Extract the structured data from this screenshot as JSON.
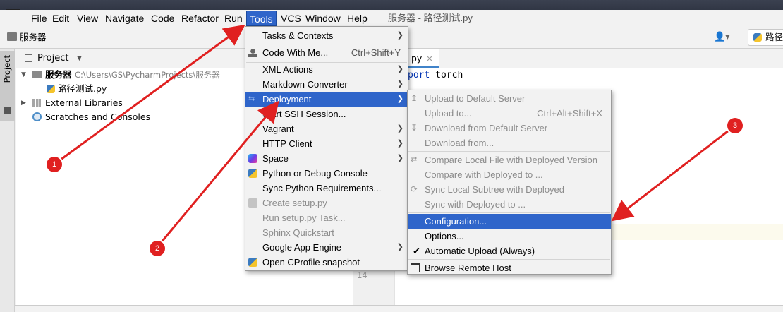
{
  "menubar": {
    "logo": "PC",
    "items": [
      {
        "label": "File"
      },
      {
        "label": "Edit"
      },
      {
        "label": "View"
      },
      {
        "label": "Navigate"
      },
      {
        "label": "Code"
      },
      {
        "label": "Refactor"
      },
      {
        "label": "Run"
      },
      {
        "label": "Tools"
      },
      {
        "label": "VCS"
      },
      {
        "label": "Window"
      },
      {
        "label": "Help"
      }
    ],
    "window_title": "服务器 - 路径测试.py"
  },
  "navbar": {
    "breadcrumb": "服务器",
    "run_config": "路径"
  },
  "sidebar_stripe": {
    "project_tab": "Project"
  },
  "project_panel": {
    "title": "Project",
    "root_name": "服务器",
    "root_path": "C:\\Users\\GS\\PycharmProjects\\服务器",
    "file": "路径测试.py",
    "external_libraries": "External Libraries",
    "scratches": "Scratches and Consoles"
  },
  "editor": {
    "tab_label": "py",
    "code_keyword": "port",
    "code_rest": " torch",
    "line_14": "14"
  },
  "tools_menu": {
    "items": [
      {
        "label": "Tasks & Contexts",
        "shortcut": "",
        "submenu": true,
        "disabled": false
      },
      {
        "label": "Code With Me...",
        "shortcut": "Ctrl+Shift+Y",
        "submenu": false,
        "disabled": false
      },
      {
        "label": "XML Actions",
        "shortcut": "",
        "submenu": true,
        "disabled": false
      },
      {
        "label": "Markdown Converter",
        "shortcut": "",
        "submenu": true,
        "disabled": false
      },
      {
        "label": "Deployment",
        "shortcut": "",
        "submenu": true,
        "disabled": false
      },
      {
        "label": "Start SSH Session...",
        "shortcut": "",
        "submenu": false,
        "disabled": false
      },
      {
        "label": "Vagrant",
        "shortcut": "",
        "submenu": true,
        "disabled": false
      },
      {
        "label": "HTTP Client",
        "shortcut": "",
        "submenu": true,
        "disabled": false
      },
      {
        "label": "Space",
        "shortcut": "",
        "submenu": true,
        "disabled": false
      },
      {
        "label": "Python or Debug Console",
        "shortcut": "",
        "submenu": false,
        "disabled": false
      },
      {
        "label": "Sync Python Requirements...",
        "shortcut": "",
        "submenu": false,
        "disabled": false
      },
      {
        "label": "Create setup.py",
        "shortcut": "",
        "submenu": false,
        "disabled": true
      },
      {
        "label": "Run setup.py Task...",
        "shortcut": "",
        "submenu": false,
        "disabled": true
      },
      {
        "label": "Sphinx Quickstart",
        "shortcut": "",
        "submenu": false,
        "disabled": true
      },
      {
        "label": "Google App Engine",
        "shortcut": "",
        "submenu": true,
        "disabled": false
      },
      {
        "label": "Open CProfile snapshot",
        "shortcut": "",
        "submenu": false,
        "disabled": false
      }
    ]
  },
  "deployment_menu": {
    "items": [
      {
        "label": "Upload to Default Server",
        "shortcut": "",
        "disabled": true
      },
      {
        "label": "Upload to...",
        "shortcut": "Ctrl+Alt+Shift+X",
        "disabled": true
      },
      {
        "label": "Download from Default Server",
        "shortcut": "",
        "disabled": true
      },
      {
        "label": "Download from...",
        "shortcut": "",
        "disabled": true
      },
      {
        "label": "Compare Local File with Deployed Version",
        "shortcut": "",
        "disabled": true
      },
      {
        "label": "Compare with Deployed to ...",
        "shortcut": "",
        "disabled": true
      },
      {
        "label": "Sync Local Subtree with Deployed",
        "shortcut": "",
        "disabled": true
      },
      {
        "label": "Sync with Deployed to ...",
        "shortcut": "",
        "disabled": true
      },
      {
        "label": "Configuration...",
        "shortcut": "",
        "disabled": false
      },
      {
        "label": "Options...",
        "shortcut": "",
        "disabled": false
      },
      {
        "label": "Automatic Upload (Always)",
        "shortcut": "",
        "disabled": false,
        "checked": true
      },
      {
        "label": "Browse Remote Host",
        "shortcut": "",
        "disabled": false
      }
    ]
  },
  "annotations": {
    "badges": [
      "1",
      "2",
      "3"
    ],
    "color": "#e02020"
  },
  "colors": {
    "selection": "#2f65ca",
    "accent": "#4083c9"
  }
}
